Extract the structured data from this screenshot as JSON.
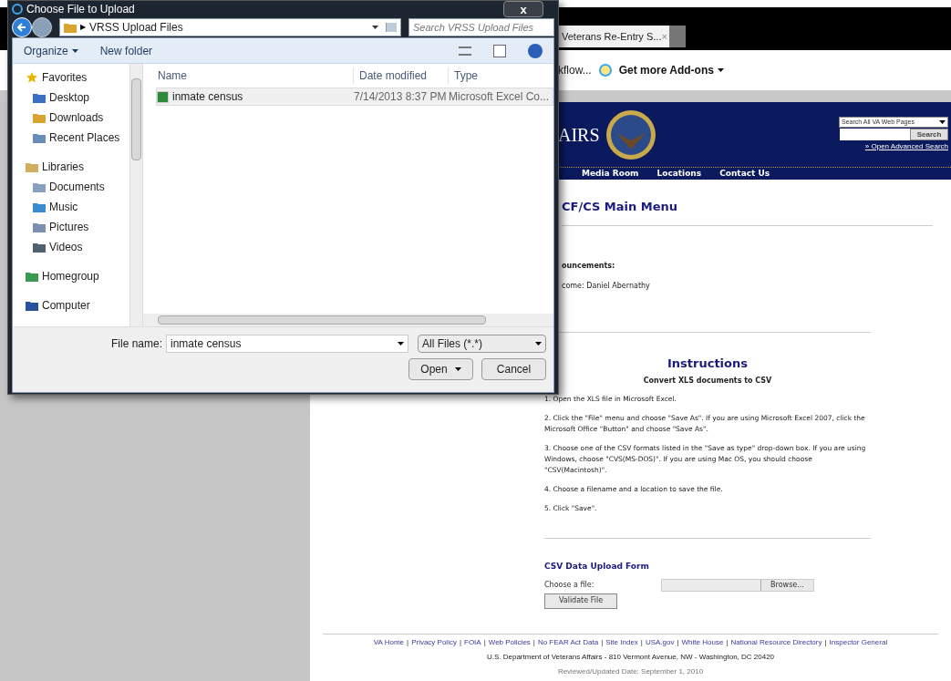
{
  "browser": {
    "tab": {
      "title": "Veterans Re-Entry S...",
      "close": "×"
    },
    "toolbar": {
      "cut_item": "kflow...",
      "addons": "Get more Add-ons"
    },
    "site": {
      "logo_text": "AIRS",
      "search": {
        "scope": "Search All VA Web Pages",
        "button": "Search",
        "advanced": "» Open Advanced Search"
      },
      "nav": [
        "Media Room",
        "Locations",
        "Contact Us"
      ]
    },
    "page": {
      "title": "CF/CS Main Menu",
      "announcements": "ouncements:",
      "welcome": "come: Daniel Abernathy",
      "instructions": {
        "title": "Instructions",
        "subtitle": "Convert XLS documents to CSV",
        "steps": [
          "1. Open the XLS file in Microsoft Excel.",
          "2. Click the \"File\" menu and choose \"Save As\". If you are using Microsoft Excel 2007, click the Microsoft Office \"Button\" and choose \"Save As\".",
          "3. Choose one of the CSV formats listed in the \"Save as type\" drop-down box. If you are using Windows, choose \"CVS(MS-DOS)\". If you are using Mac OS, you should choose \"CSV(Macintosh)\".",
          "4. Choose a filename and a location to save the file.",
          "5. Click \"Save\"."
        ]
      },
      "form": {
        "title": "CSV Data Upload Form",
        "file_label": "Choose a file:",
        "browse": "Browse...",
        "validate": "Validate File"
      },
      "footer": {
        "links": [
          "VA Home",
          "Privacy Policy",
          "FOIA",
          "Web Policies",
          "No FEAR Act Data",
          "Site Index",
          "USA.gov",
          "White House",
          "National Resource Directory",
          "Inspector General"
        ],
        "separator": "|",
        "address": "U.S. Department of Veterans Affairs - 810 Vermont Avenue, NW - Washington, DC 20420",
        "reviewed": "Reviewed/Updated Date: September 1, 2010"
      }
    }
  },
  "dialog": {
    "title": "Choose File to Upload",
    "close": "x",
    "breadcrumb_separator": "▶",
    "path": "VRSS Upload Files",
    "search": {
      "placeholder": "Search VRSS Upload Files"
    },
    "toolbar": [
      "Organize",
      "New folder"
    ],
    "sidebar": [
      {
        "label": "Favorites",
        "children": [
          {
            "label": "Desktop"
          },
          {
            "label": "Downloads"
          },
          {
            "label": "Recent Places"
          }
        ]
      },
      {
        "label": "Libraries",
        "children": [
          {
            "label": "Documents"
          },
          {
            "label": "Music"
          },
          {
            "label": "Pictures"
          },
          {
            "label": "Videos"
          }
        ]
      },
      {
        "label": "Homegroup"
      },
      {
        "label": "Computer"
      }
    ],
    "columns": [
      "Name",
      "Date modified",
      "Type"
    ],
    "files": [
      {
        "name": "inmate census",
        "date": "7/14/2013 8:37 PM",
        "type": "Microsoft Excel Co...",
        "selected": true
      }
    ],
    "file_name": {
      "label": "File name:",
      "value": "inmate census"
    },
    "filter": "All Files (*.*)",
    "buttons": [
      "Open",
      "Cancel"
    ]
  }
}
